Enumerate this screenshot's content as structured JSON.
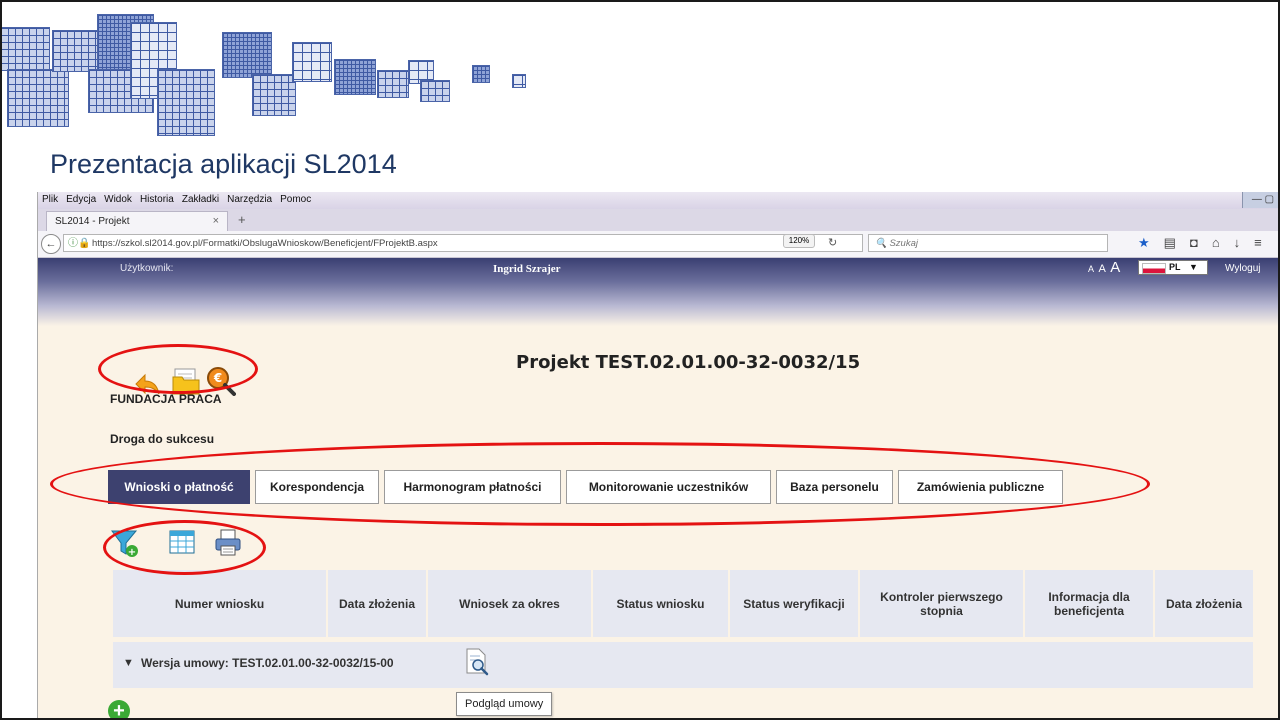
{
  "slide": {
    "title": "Prezentacja aplikacji SL2014"
  },
  "browser": {
    "menu": [
      "Plik",
      "Edycja",
      "Widok",
      "Historia",
      "Zakładki",
      "Narzędzia",
      "Pomoc"
    ],
    "tab_title": "SL2014 - Projekt",
    "tab_close": "×",
    "new_tab": "+",
    "url": "https://szkol.sl2014.gov.pl/Formatki/ObslugaWnioskow/Beneficjent/FProjektB.aspx",
    "zoom": "120%",
    "search_placeholder": "Szukaj",
    "icons": [
      "back-icon",
      "lock-icon",
      "reload-icon",
      "search-icon",
      "star-icon",
      "reader-icon",
      "pocket-icon",
      "home-icon",
      "download-icon",
      "menu-icon"
    ]
  },
  "app_header": {
    "user_label": "Użytkownik:",
    "user_name": "Ingrid Szrajer",
    "font_sizes": [
      "A",
      "A",
      "A"
    ],
    "language": "PL",
    "logout": "Wyloguj"
  },
  "project": {
    "title": "Projekt TEST.02.01.00-32-0032/15",
    "organization": "FUNDACJA PRACA",
    "name": "Droga do sukcesu",
    "action_icons": [
      "back-arrow-icon",
      "folder-icon",
      "money-search-icon"
    ]
  },
  "tabs": [
    {
      "label": "Wnioski o płatność",
      "active": true
    },
    {
      "label": "Korespondencja",
      "active": false
    },
    {
      "label": "Harmonogram płatności",
      "active": false
    },
    {
      "label": "Monitorowanie uczestników",
      "active": false
    },
    {
      "label": "Baza personelu",
      "active": false
    },
    {
      "label": "Zamówienia publiczne",
      "active": false
    }
  ],
  "toolbar_icons": [
    "filter-add-icon",
    "table-columns-icon",
    "print-icon"
  ],
  "table": {
    "columns": [
      "Numer wniosku",
      "Data złożenia",
      "Wniosek za okres",
      "Status wniosku",
      "Status weryfikacji",
      "Kontroler pierwszego stopnia",
      "Informacja dla beneficjenta",
      "Data złożenia"
    ],
    "group_label": "Wersja umowy: TEST.02.01.00-32-0032/15-00",
    "tooltip": "Podgląd umowy"
  },
  "colors": {
    "active_tab": "#3d416f",
    "annotation": "#e41212",
    "background": "#fbf3e6"
  }
}
